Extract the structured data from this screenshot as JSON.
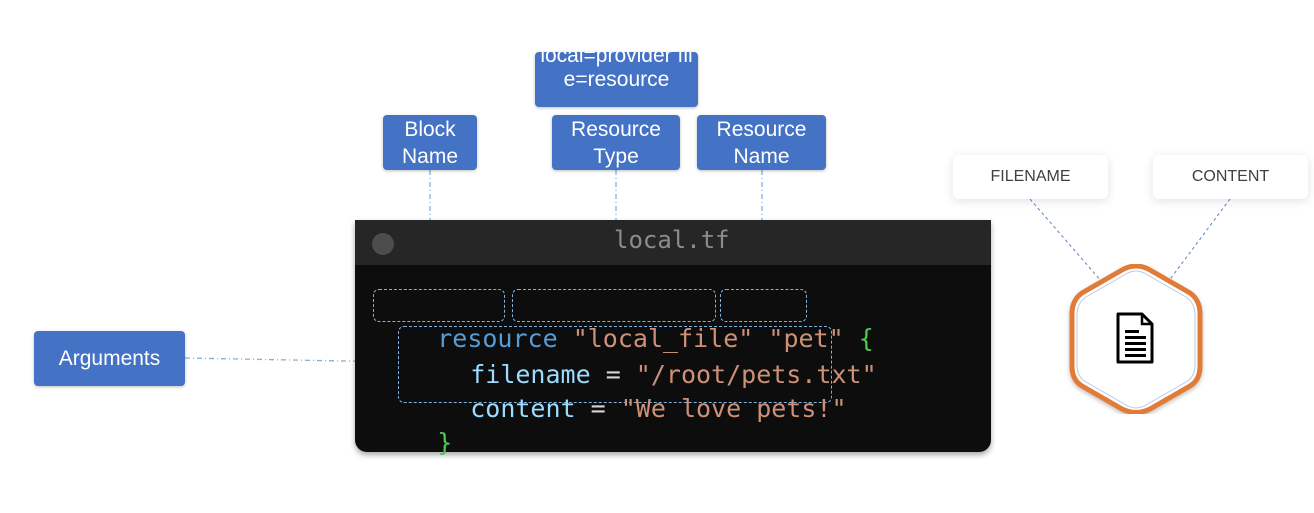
{
  "labels": {
    "provider_note": "local=provider file=resource",
    "block_name": [
      "Block",
      "Name"
    ],
    "resource_type": [
      "Resource",
      "Type"
    ],
    "resource_name": [
      "Resource",
      "Name"
    ],
    "arguments": "Arguments"
  },
  "terminal": {
    "title": "local.tf",
    "line1": {
      "keyword": "resource",
      "type": "\"local_file\"",
      "name": "\"pet\"",
      "brace_open": "{"
    },
    "line2": {
      "attr": "filename",
      "eq": " = ",
      "value": "\"/root/pets.txt\""
    },
    "line3": {
      "attr": "content",
      "eq": " = ",
      "value": "\"We love pets!\""
    },
    "line4": {
      "brace_close": "}"
    }
  },
  "resource_cards": {
    "filename": "FILENAME",
    "content": "CONTENT"
  },
  "icons": {
    "file": "document-icon",
    "dot": "window-dot-icon"
  },
  "colors": {
    "label_blue": "#4472c4",
    "hexagon_border": "#e07b39",
    "keyword": "#569cd6",
    "string": "#ce9178",
    "attribute": "#9cdcfe",
    "brace": "#4ec94e"
  }
}
